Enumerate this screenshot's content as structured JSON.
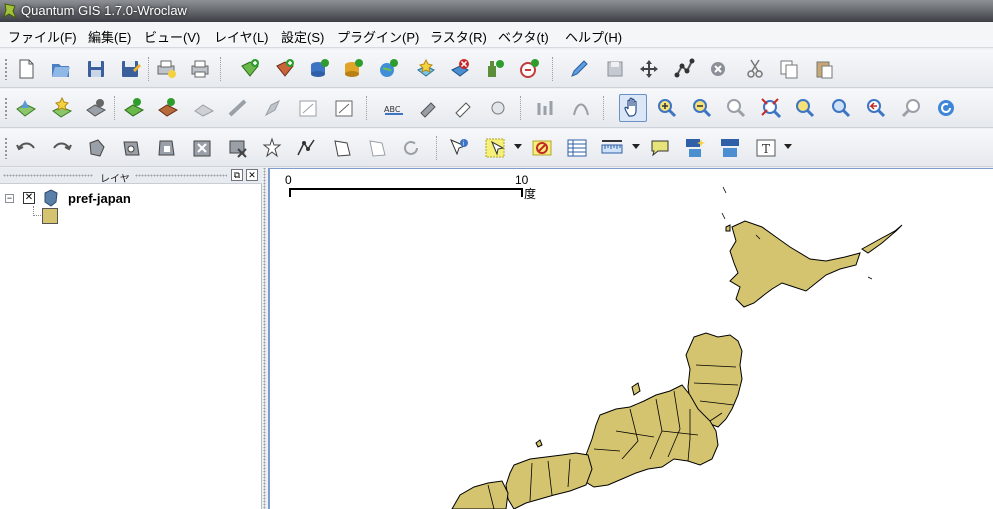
{
  "window": {
    "title": "Quantum GIS 1.7.0-Wroclaw"
  },
  "menu": [
    "ファイル(F)",
    "編集(E)",
    "ビュー(V)",
    "レイヤ(L)",
    "設定(S)",
    "プラグイン(P)",
    "ラスタ(R)",
    "ベクタ(t)",
    "ヘルプ(H)"
  ],
  "toolbar_icons": {
    "row1": [
      "new-project-icon",
      "open-project-icon",
      "save-project-icon",
      "save-as-icon",
      "print-composer-icon",
      "print-icon",
      "add-vector-layer-icon",
      "add-raster-layer-icon",
      "add-postgis-layer-icon",
      "add-spatialite-layer-icon",
      "add-wms-layer-icon",
      "new-layer-icon",
      "remove-layer-icon",
      "add-wfs-layer-icon",
      "add-wcs-layer-icon",
      "toggle-editing-icon",
      "save-edits-icon",
      "move-feature-icon",
      "node-tool-icon",
      "delete-selected-icon",
      "cut-features-icon",
      "copy-features-icon",
      "paste-features-icon"
    ],
    "row2": [
      "show-all-layers-icon",
      "star-layer-icon",
      "hide-layers-icon",
      "layer-style-icon",
      "layer-properties-icon",
      "grayed-layer-icon",
      "measure-line-icon",
      "measure-area-icon",
      "measure-angle-icon",
      "overview-icon",
      "label-abc-icon",
      "move-label-icon",
      "rotate-label-icon",
      "change-label-icon",
      "diagram-icon",
      "pin-labels-icon",
      "pan-hand-icon",
      "zoom-in-icon",
      "zoom-out-icon",
      "zoom-full-icon",
      "zoom-to-selection-icon",
      "zoom-to-layer-icon",
      "zoom-actual-icon",
      "zoom-last-icon",
      "zoom-next-icon",
      "refresh-icon"
    ],
    "row3": [
      "undo-icon",
      "redo-icon",
      "simplify-icon",
      "add-ring-icon",
      "add-part-icon",
      "fill-ring-icon",
      "delete-ring-icon",
      "delete-part-icon",
      "reshape-icon",
      "offset-curve-icon",
      "split-features-icon",
      "merge-features-icon",
      "merge-attributes-icon",
      "rotate-point-icon",
      "identify-icon",
      "select-icon",
      "deselect-icon",
      "attribute-table-icon",
      "measure-icon",
      "map-tips-icon",
      "new-bookmark-icon",
      "show-bookmarks-icon",
      "text-annotation-icon"
    ]
  },
  "layers_panel": {
    "title": "レイヤ",
    "layers": [
      {
        "name": "pref-japan",
        "visible": true,
        "fill_color": "#d4c46f"
      }
    ]
  },
  "map": {
    "scale_bar": {
      "start": "0",
      "end": "10",
      "unit": "度"
    },
    "fill_color": "#d4c46f",
    "stroke_color": "#000000",
    "layer_rendered": "pref-japan"
  }
}
